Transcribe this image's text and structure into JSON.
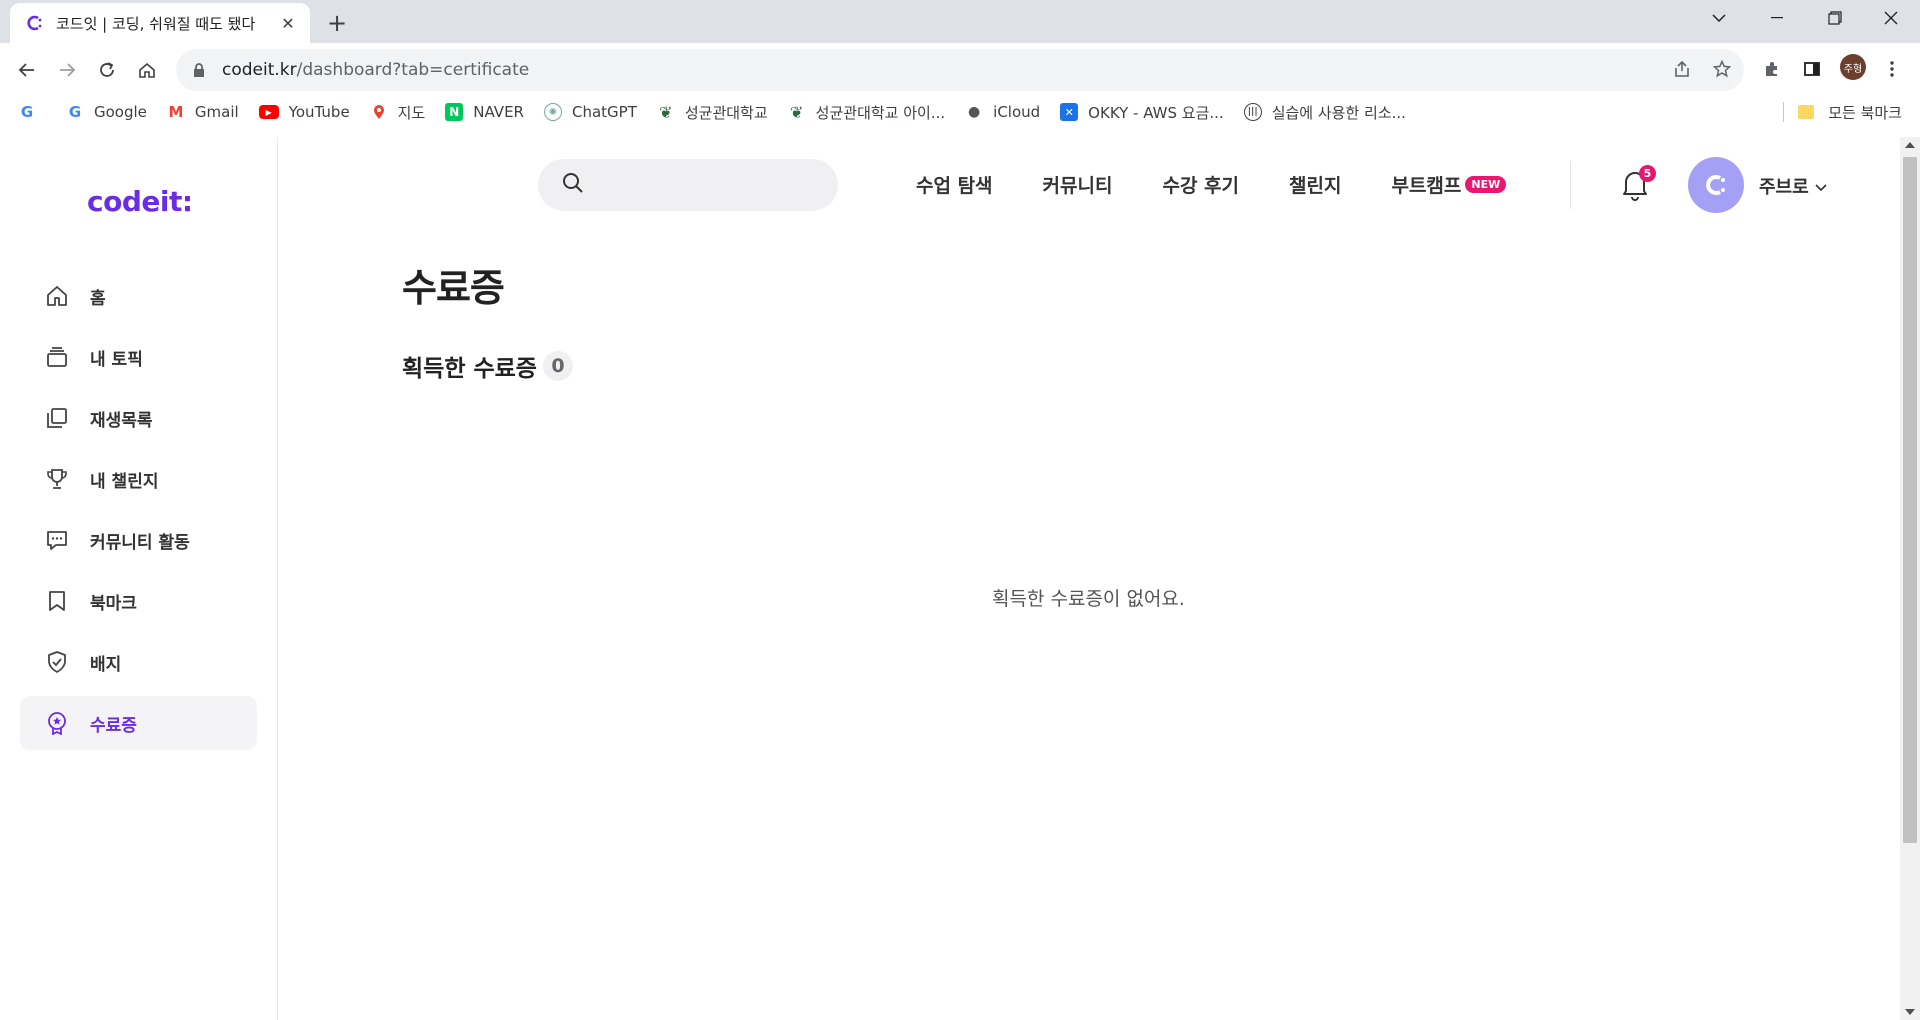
{
  "browser": {
    "tab_title": "코드잇 | 코딩, 쉬워질 때도 됐다",
    "url_host": "codeit.kr",
    "url_path": "/dashboard?tab=certificate",
    "profile_initials": "주형"
  },
  "bookmarks": [
    {
      "icon": "google-icon",
      "label": ""
    },
    {
      "icon": "google-icon",
      "label": "Google"
    },
    {
      "icon": "gmail-icon",
      "label": "Gmail"
    },
    {
      "icon": "youtube-icon",
      "label": "YouTube"
    },
    {
      "icon": "maps-icon",
      "label": "지도"
    },
    {
      "icon": "naver-icon",
      "label": "NAVER"
    },
    {
      "icon": "chatgpt-icon",
      "label": "ChatGPT"
    },
    {
      "icon": "skku-icon",
      "label": "성균관대학교"
    },
    {
      "icon": "skku-icon",
      "label": "성균관대학교 아이..."
    },
    {
      "icon": "apple-icon",
      "label": "iCloud"
    },
    {
      "icon": "okky-icon",
      "label": "OKKY - AWS 요금..."
    },
    {
      "icon": "globe-icon",
      "label": "실습에 사용한 리소..."
    }
  ],
  "bookmarks_all": "모든 북마크",
  "site": {
    "logo": "codeit",
    "logo_suffix": ":",
    "sidebar": [
      {
        "label": "홈",
        "icon": "home-icon"
      },
      {
        "label": "내 토픽",
        "icon": "stack-icon"
      },
      {
        "label": "재생목록",
        "icon": "playlist-icon"
      },
      {
        "label": "내 챌린지",
        "icon": "trophy-icon"
      },
      {
        "label": "커뮤니티 활동",
        "icon": "chat-icon"
      },
      {
        "label": "북마크",
        "icon": "bookmark-icon"
      },
      {
        "label": "배지",
        "icon": "badge-icon"
      },
      {
        "label": "수료증",
        "icon": "certificate-icon",
        "active": true
      }
    ],
    "nav": [
      {
        "label": "수업 탐색"
      },
      {
        "label": "커뮤니티"
      },
      {
        "label": "수강 후기"
      },
      {
        "label": "챌린지"
      },
      {
        "label": "부트캠프",
        "badge": "NEW"
      }
    ],
    "notification_count": "5",
    "username": "주브로"
  },
  "main": {
    "title": "수료증",
    "section_title": "획득한 수료증",
    "count": "0",
    "empty_message": "획득한 수료증이 없어요."
  },
  "colors": {
    "brand": "#6a2de4",
    "new_badge": "#e8176f",
    "avatar": "#a3a0f5"
  }
}
